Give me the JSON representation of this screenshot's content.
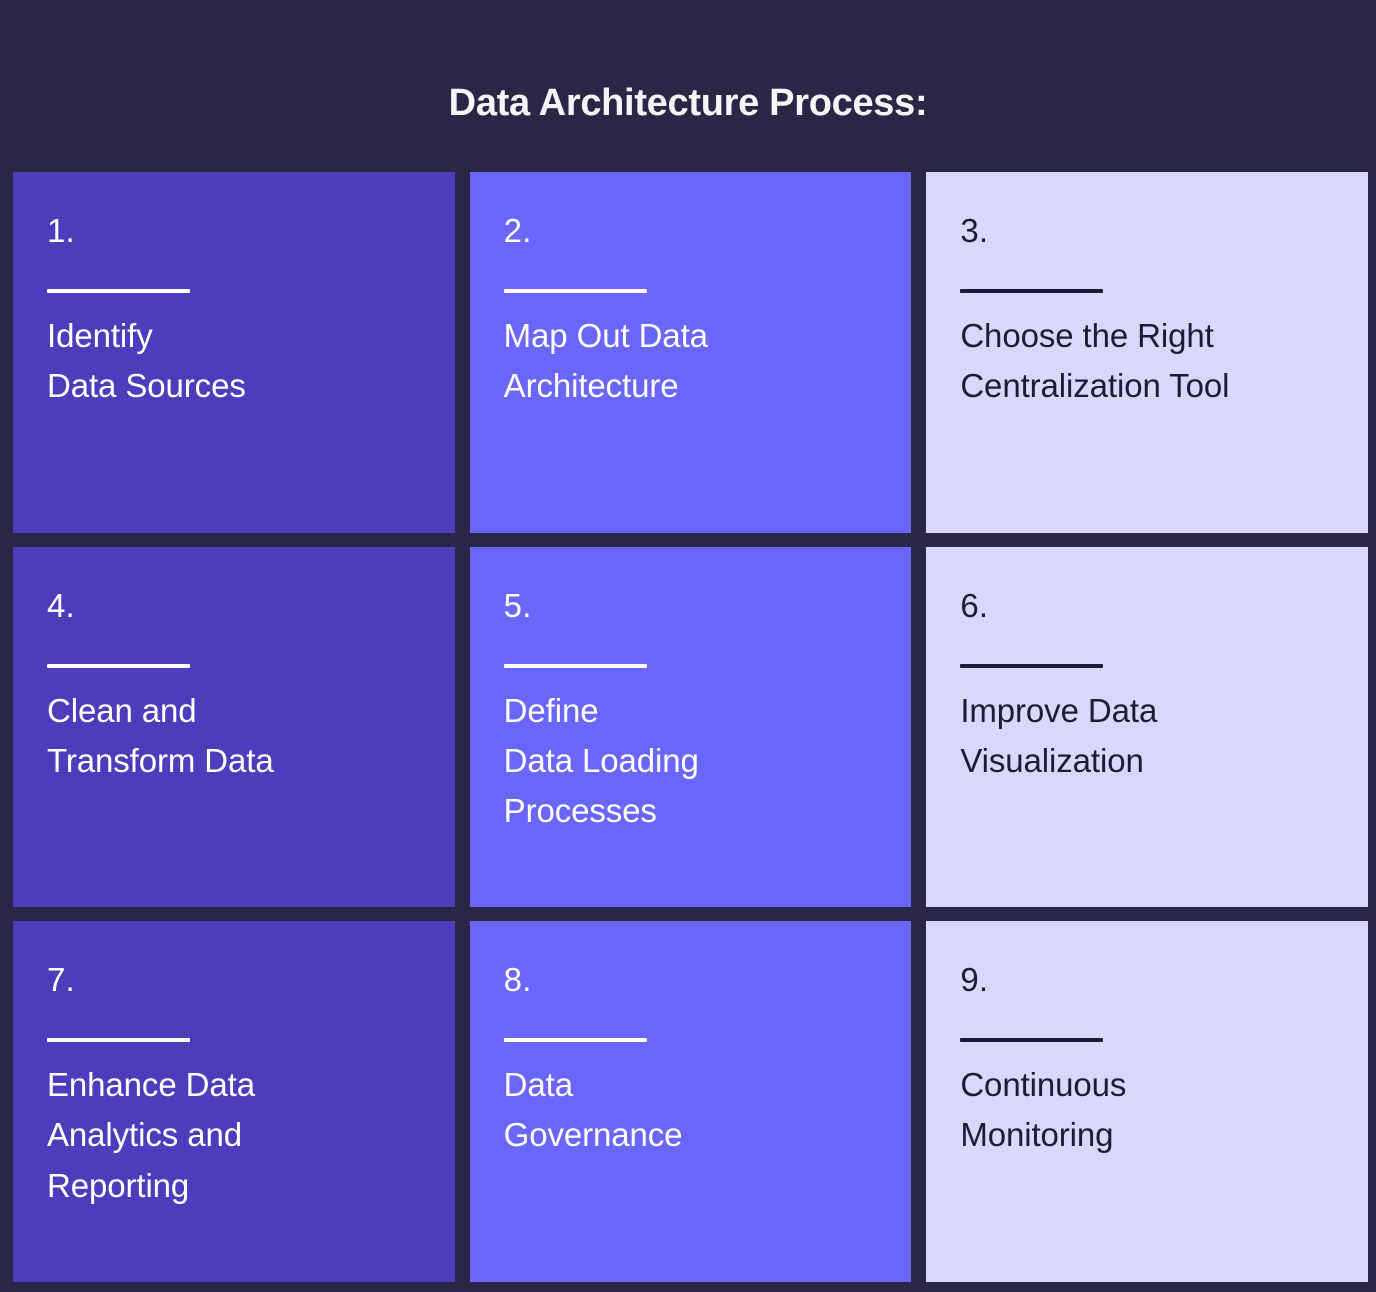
{
  "title": "Data Architecture Process:",
  "colors": {
    "background": "#2a2746",
    "tone_dark": "#4d3cbc",
    "tone_mid": "#6a66fa",
    "tone_light": "#d8d8fb",
    "text_on_dark": "#ffffff",
    "text_on_light": "#1d1b36"
  },
  "steps": [
    {
      "number": "1.",
      "label": "Identify\nData Sources",
      "tone": "tone-dark"
    },
    {
      "number": "2.",
      "label": "Map Out Data\nArchitecture",
      "tone": "tone-mid"
    },
    {
      "number": "3.",
      "label": "Choose the Right\nCentralization Tool",
      "tone": "tone-light"
    },
    {
      "number": "4.",
      "label": "Clean and\nTransform Data",
      "tone": "tone-dark"
    },
    {
      "number": "5.",
      "label": "Define\nData Loading\nProcesses",
      "tone": "tone-mid"
    },
    {
      "number": "6.",
      "label": "Improve Data\nVisualization",
      "tone": "tone-light"
    },
    {
      "number": "7.",
      "label": "Enhance Data\nAnalytics and\nReporting",
      "tone": "tone-dark"
    },
    {
      "number": "8.",
      "label": "Data\nGovernance",
      "tone": "tone-mid"
    },
    {
      "number": "9.",
      "label": "Continuous\nMonitoring",
      "tone": "tone-light"
    }
  ]
}
